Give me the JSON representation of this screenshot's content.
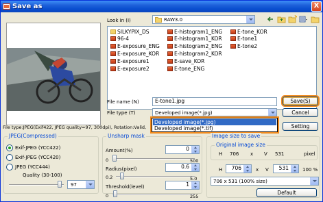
{
  "window": {
    "title": "Save as",
    "close_glyph": "X"
  },
  "look_in": {
    "label": "Look in (I)",
    "value": "RAW3.0"
  },
  "files": [
    {
      "name": "SILKYPIX_DS",
      "type": "folder"
    },
    {
      "name": "96-4",
      "type": "image"
    },
    {
      "name": "E-exposure_ENG",
      "type": "image"
    },
    {
      "name": "E-exposure_KOR",
      "type": "image"
    },
    {
      "name": "E-exposure1",
      "type": "image"
    },
    {
      "name": "E-exposure2",
      "type": "image"
    },
    {
      "name": "E-histogram1_ENG",
      "type": "image"
    },
    {
      "name": "E-histogram1_KOR",
      "type": "image"
    },
    {
      "name": "E-histogram2_ENG",
      "type": "image"
    },
    {
      "name": "E-histogram2_KOR",
      "type": "image"
    },
    {
      "name": "E-save_KOR",
      "type": "image"
    },
    {
      "name": "E-tone_ENG",
      "type": "image"
    },
    {
      "name": "E-tone_KOR",
      "type": "image"
    },
    {
      "name": "E-tone1",
      "type": "image"
    },
    {
      "name": "E-tone2",
      "type": "image"
    }
  ],
  "file_name": {
    "label": "File name (N)",
    "value": "E-tone1.jpg"
  },
  "file_type": {
    "label": "File type (T)",
    "value": "Developed image(*.jpg)",
    "options": [
      "Developed image(*.jpg)",
      "Developed image(*.tif)"
    ]
  },
  "buttons": {
    "save": "Save(S)",
    "cancel": "Cancel",
    "setting": "Setting",
    "default": "Default"
  },
  "file_info": "File type:JPEG(Exif422, JPEG quality=97, 300dpi), Rotation:Valid,",
  "jpeg": {
    "title": "JPEG(Compressed)",
    "options": [
      "Exif-JPEG (YCC422)",
      "Exif-JPEG (YCC420)",
      "JPEG (YCC444)"
    ],
    "selected": 0,
    "quality_label": "Quality (30-100)",
    "quality_value": "97",
    "quality_min": 30,
    "quality_max": 100
  },
  "unsharp": {
    "title": "Unsharp mask",
    "amount": {
      "label": "Amount(%)",
      "value": "0",
      "min": "0",
      "max": "500"
    },
    "radius": {
      "label": "Radius(pixel)",
      "value": "0.6",
      "min": "0.2",
      "max": "5.0"
    },
    "threshold": {
      "label": "Threshold(level)",
      "value": "1",
      "min": "0",
      "max": "255"
    }
  },
  "image_size": {
    "title": "Image size to save",
    "original_title": "Original image size",
    "h_label": "H",
    "x_label": "x",
    "v_label": "V",
    "unit": "pixel",
    "orig_h": "706",
    "orig_v": "531",
    "h_value": "706",
    "v_value": "531",
    "percent": "100 %",
    "preset": "706 x 531 (100% size)"
  }
}
